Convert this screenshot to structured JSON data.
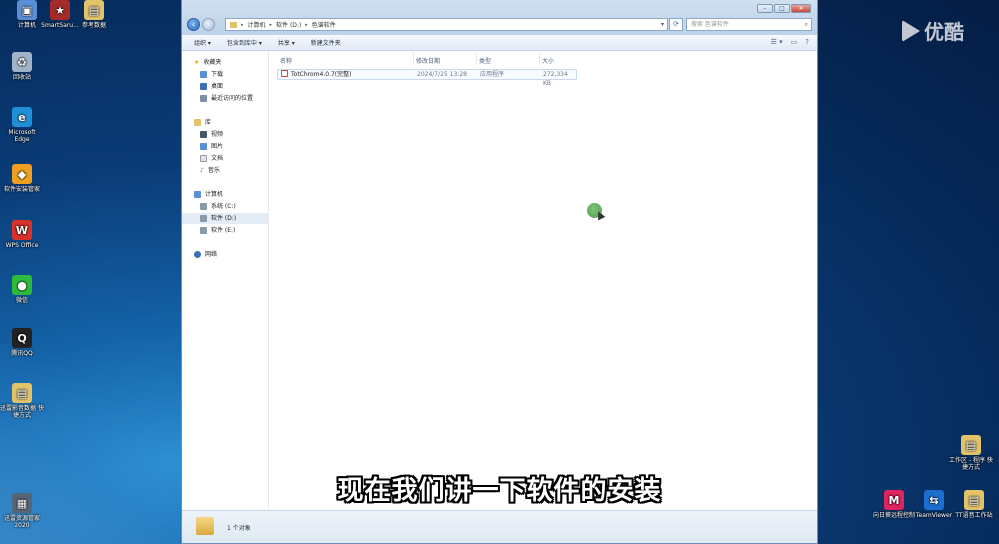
{
  "desktop_left_icons": [
    {
      "label": "计算机",
      "icon": "computer-icon",
      "color": "#5a8fd6",
      "glyph": "▣"
    },
    {
      "label": "SmartSaru...",
      "icon": "smart-app-icon",
      "color": "#a52a2a",
      "glyph": "★"
    },
    {
      "label": "参考数据",
      "icon": "document-icon",
      "color": "#e2c36a",
      "glyph": "▤"
    },
    {
      "label": "回收站",
      "icon": "recycle-bin-icon",
      "color": "#9fb4c8",
      "glyph": "♻"
    },
    {
      "label": "Microsoft Edge",
      "icon": "edge-icon",
      "color": "#1f8fd8",
      "glyph": "e"
    },
    {
      "label": "软件安装管家",
      "icon": "installer-icon",
      "color": "#f0a020",
      "glyph": "◆"
    },
    {
      "label": "WPS Office",
      "icon": "wps-icon",
      "color": "#d9322b",
      "glyph": "W"
    },
    {
      "label": "微信",
      "icon": "wechat-icon",
      "color": "#2dbb3c",
      "glyph": "●"
    },
    {
      "label": "腾讯QQ",
      "icon": "qq-icon",
      "color": "#222222",
      "glyph": "Q"
    },
    {
      "label": "迅雷影音数据 快捷方式",
      "icon": "shortcut-icon",
      "color": "#e2c36a",
      "glyph": "▤"
    },
    {
      "label": "迅雷资源管家 2020",
      "icon": "manager-icon",
      "color": "#556677",
      "glyph": "▦"
    }
  ],
  "desktop_right_icons": [
    {
      "label": "工作区 - 程序 快捷方式",
      "icon": "folder-shortcut-icon",
      "color": "#e2c36a",
      "glyph": "▤"
    },
    {
      "label": "向日葵远程控制",
      "icon": "remote-control-icon",
      "color": "#e0245e",
      "glyph": "M"
    },
    {
      "label": "TeamViewer",
      "icon": "teamviewer-icon",
      "color": "#1c6fd1",
      "glyph": "⇆"
    },
    {
      "label": "TT语音工作站",
      "icon": "tt-icon",
      "color": "#e2c36a",
      "glyph": "▤"
    }
  ],
  "watermark": {
    "brand": "优酷"
  },
  "window": {
    "address": [
      "计算机",
      "软件 (D:)",
      "色谱软件"
    ],
    "search_placeholder": "搜索 色谱软件",
    "toolbar": [
      "组织 ▾",
      "包含到库中 ▾",
      "共享 ▾",
      "新建文件夹"
    ],
    "nav": {
      "favorites": [
        "收藏夹",
        "下载",
        "桌面",
        "最近访问的位置"
      ],
      "libraries": [
        "库",
        "视频",
        "图片",
        "文档",
        "音乐"
      ],
      "computer": [
        "计算机",
        "系统 (C:)",
        "软件 (D:)",
        "软件 (E:)"
      ],
      "network": [
        "网络"
      ]
    },
    "columns": [
      "名称",
      "修改日期",
      "类型",
      "大小"
    ],
    "files": [
      {
        "name": "TotChrom4.0.7(完整)",
        "modified": "2024/7/25 13:28",
        "type": "应用程序",
        "size": "272,334 KB"
      }
    ],
    "status": "1 个对象"
  },
  "subtitle": "现在我们讲一下软件的安装",
  "colors": {
    "accent": "#2a6bc1",
    "desktop": "#0b3c78"
  }
}
